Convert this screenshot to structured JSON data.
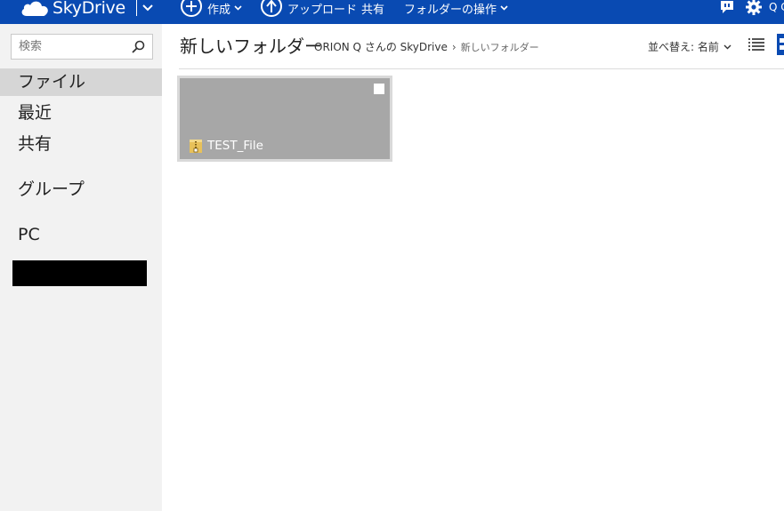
{
  "app": {
    "name": "SkyDrive",
    "user_short": "Q C"
  },
  "toolbar": {
    "create_label": "作成",
    "upload_label": "アップロード",
    "share_label": "共有",
    "folder_ops_label": "フォルダーの操作"
  },
  "sidebar": {
    "search_placeholder": "検索",
    "items": [
      {
        "label": "ファイル",
        "selected": true
      },
      {
        "label": "最近",
        "selected": false
      },
      {
        "label": "共有",
        "selected": false
      },
      {
        "label": "グループ",
        "selected": false
      },
      {
        "label": "PC",
        "selected": false
      }
    ]
  },
  "main": {
    "title": "新しいフォルダー",
    "breadcrumb": {
      "root": "ORION Q さんの SkyDrive",
      "separator": "›",
      "current": "新しいフォルダー"
    },
    "sort_label": "並べ替え: 名前",
    "files": [
      {
        "name": "TEST_File",
        "icon": "zip-file-icon"
      }
    ]
  },
  "colors": {
    "topbar": "#094ab2",
    "sidebar": "#f2f2f2",
    "selected_nav": "#d6d6d6",
    "tile": "#a7a7a7"
  }
}
